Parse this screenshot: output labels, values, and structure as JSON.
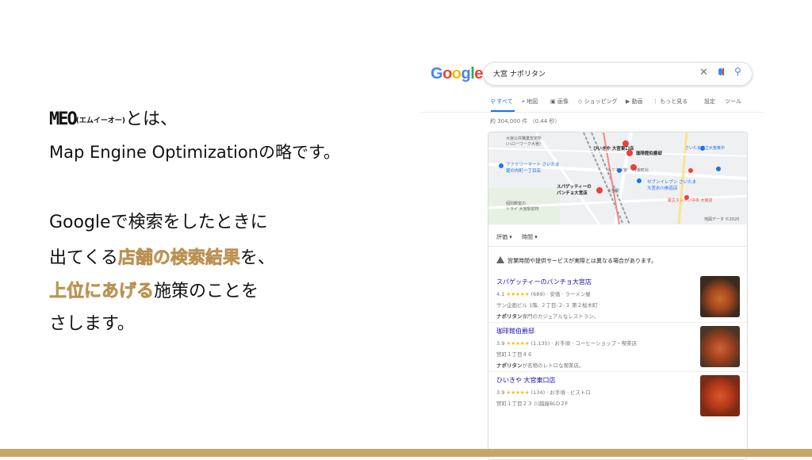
{
  "slide": {
    "line1_prefix": "MEO",
    "line1_ruby": "(エムイーオー)",
    "line1_suffix": "とは、",
    "line2": "Map Engine Optimizationの略です。",
    "line3": "Googleで検索をしたときに",
    "line4_prefix": "出てくる",
    "line4_highlight": "店舗の検索結果",
    "line4_suffix": "を、",
    "line5_highlight": "上位にあげる",
    "line5_suffix": "施策のことを",
    "line6": "さします。",
    "highlight_color": "#d8b477",
    "bottom_bar_color": "#c9a56b"
  },
  "google": {
    "logo": "Google",
    "query": "大宮 ナポリタン",
    "tabs": [
      "すべて",
      "地図",
      "画像",
      "ショッピング",
      "動画",
      "もっと見る",
      "設定",
      "ツール"
    ],
    "result_count": "約 304,000 件 （0.44 秒）",
    "map_labels": [
      "大宮公共職業安定所\n(ハローワーク大宮)",
      "ひいきや 大宮東口店",
      "珈琲館伯爵邸",
      "さいたま市立大宮東中",
      "ファミリーマート さいたま\n堀の内町一丁目店",
      "ルミネ大宮",
      "丹後町北",
      "スパゲッティーの\nパンチョ大宮店",
      "大宮駅",
      "セブンイレブン さいたま\n大宮氷川参道店",
      "蒙古タンメン中本 大宮店",
      "個別教室の\nトライ 大宮駅前校",
      "地図データ ©2020"
    ],
    "filters": [
      "評価",
      "時間"
    ],
    "notice": "営業時間や提供サービスが実際とは異なる場合があります。",
    "results": [
      {
        "name": "スパゲッティーのパンチョ大宮店",
        "rating": "4.1",
        "stars": "★★★★★",
        "reviews": "(689) · 安価 · ラーメン屋",
        "address": "サン企画ビル 1階, ２丁目-２-３ 第２桜木町",
        "desc_bold": "ナポリタン",
        "desc": "専門のカジュアルなレストラン。"
      },
      {
        "name": "珈琲館伯爵邸",
        "rating": "3.9",
        "stars": "★★★★★",
        "reviews": "(1,135) · お手頃 · コーヒーショップ・喫茶店",
        "address": "宮町１丁目４６",
        "desc_bold": "ナポリタン",
        "desc": "が名物のレトロな喫茶店。"
      },
      {
        "name": "ひいきや 大宮東口店",
        "rating": "3.9",
        "stars": "★★★★★",
        "reviews": "(134) · お手頃 · ビストロ",
        "address": "宮町１丁目２３ 川越屋BLD２F",
        "desc_bold": "",
        "desc": ""
      }
    ]
  }
}
